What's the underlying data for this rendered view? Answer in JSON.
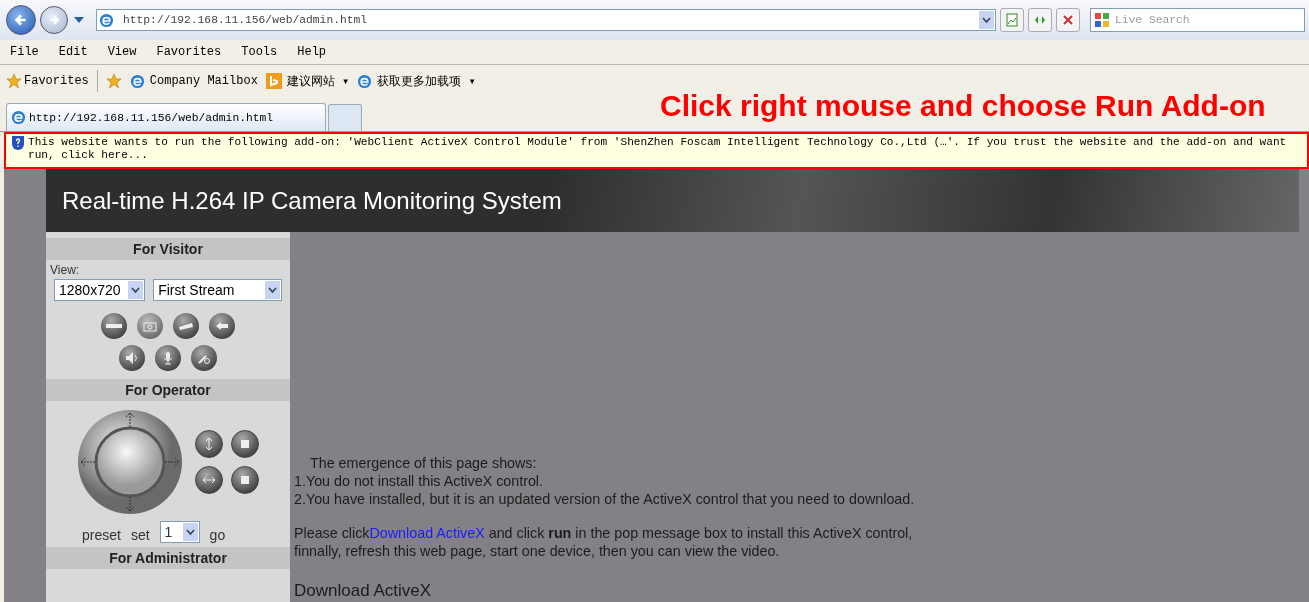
{
  "browser": {
    "address": "http://192.168.11.156/web/admin.html",
    "search_placeholder": "Live Search",
    "menu": [
      "File",
      "Edit",
      "View",
      "Favorites",
      "Tools",
      "Help"
    ],
    "favorites": [
      {
        "label": "Favorites",
        "kind": "star"
      },
      {
        "label": "Company Mailbox",
        "kind": "ie"
      },
      {
        "label": "建议网站 ▾",
        "kind": "bing"
      },
      {
        "label": "获取更多加载项 ▾",
        "kind": "ie"
      }
    ],
    "tabs": [
      {
        "label": "http://192.168.11.156/web/admin.html",
        "selected": true
      }
    ],
    "annotation": "Click right mouse and choose Run Add-on",
    "infobar": [
      "This website wants to run the following add-on: 'WebClient ActiveX Control Module' from 'ShenZhen Foscam Intelligent Technology Co.,Ltd (…'. If you trust the website and the add-on and want",
      "run, click here..."
    ]
  },
  "page": {
    "title": "Real-time H.264 IP Camera Monitoring System",
    "sidebar": {
      "visitor_heading": "For Visitor",
      "view_label": "View:",
      "resolution": "1280x720",
      "stream": "First Stream",
      "operator_heading": "For Operator",
      "preset_label": "preset",
      "set_label": "set",
      "preset_value": "1",
      "go_label": "go",
      "admin_heading": "For Administrator"
    },
    "main": {
      "intro": "The emergence of this page shows:",
      "reasons": [
        "1.You do not install this ActiveX control.",
        "2.You have installed, but it is an updated version of the ActiveX control that you need to download."
      ],
      "instruction_before": "Please click",
      "instruction_link": "Download ActiveX",
      "instruction_after": " and click **run** in the pop message box to install this ActiveX control,",
      "instruction_line2": "finnally, refresh this web page, start one device, then you can view the video.",
      "download_heading": "Download ActiveX"
    }
  }
}
